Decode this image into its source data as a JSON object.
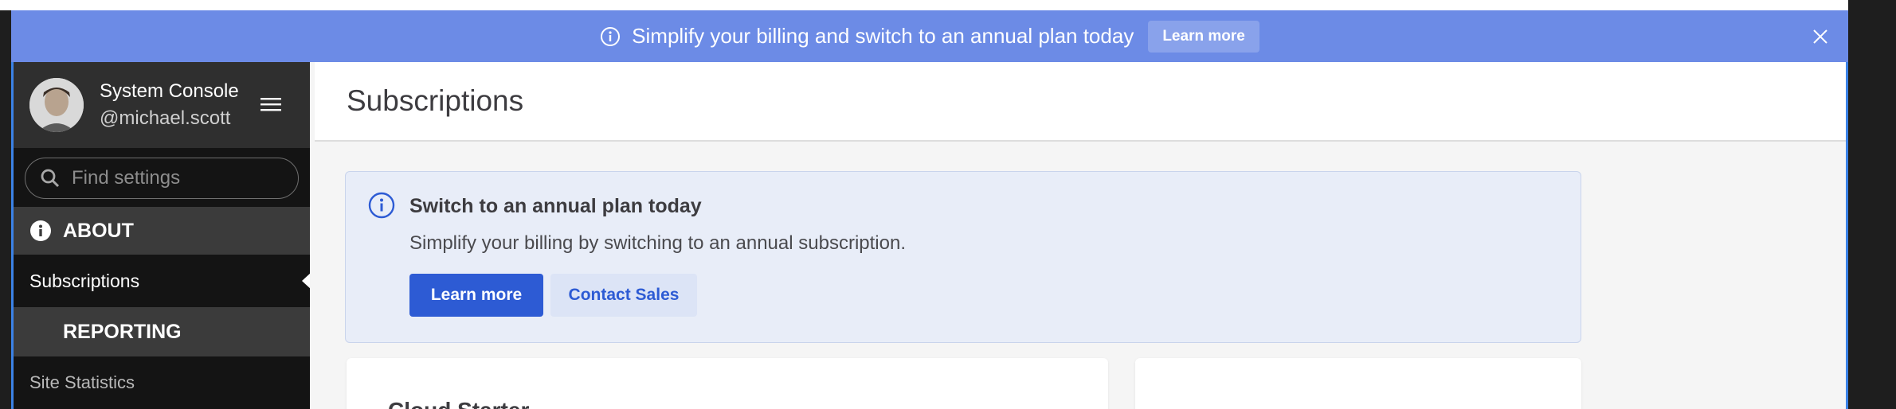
{
  "banner": {
    "text": "Simplify your billing and switch to an annual plan today",
    "button_label": "Learn more"
  },
  "sidebar": {
    "title": "System Console",
    "username": "@michael.scott",
    "search_placeholder": "Find settings",
    "sections": [
      {
        "label": "ABOUT"
      },
      {
        "label": "REPORTING"
      }
    ],
    "active_item": "Subscriptions",
    "items": [
      {
        "label": "Site Statistics"
      }
    ]
  },
  "main": {
    "title": "Subscriptions",
    "callout": {
      "title": "Switch to an annual plan today",
      "text": "Simplify your billing by switching to an annual subscription.",
      "primary_button": "Learn more",
      "secondary_button": "Contact Sales"
    },
    "card": {
      "title": "Cloud Starter"
    }
  },
  "colors": {
    "banner": "#6c8be6",
    "primary": "#2d5bd4",
    "sidebar_bg": "#141414",
    "sidebar_section": "#3b3b3b",
    "callout_bg": "#e8edf8"
  },
  "icons": [
    "info-icon",
    "close-icon",
    "avatar",
    "menu-icon",
    "search-icon",
    "about-icon"
  ]
}
